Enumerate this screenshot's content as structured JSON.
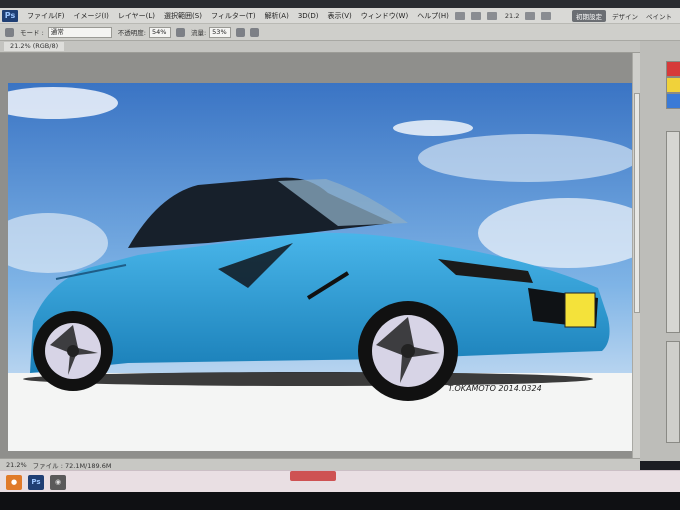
{
  "app": {
    "logo": "Ps"
  },
  "menu": {
    "items": [
      "ファイル(F)",
      "イメージ(I)",
      "レイヤー(L)",
      "選択範囲(S)",
      "フィルター(T)",
      "解析(A)",
      "3D(D)",
      "表示(V)",
      "ウィンドウ(W)",
      "ヘルプ(H)"
    ],
    "zoom": "21.2"
  },
  "workspace": {
    "essentials": "初期設定",
    "design": "デザイン",
    "paint": "ペイント"
  },
  "options": {
    "mode_label": "モード :",
    "mode_value": "通常",
    "opacity_label": "不透明度:",
    "opacity_value": "54%",
    "flow_label": "流量:",
    "flow_value": "53%"
  },
  "document": {
    "tab": "21.2% (RGB/8)"
  },
  "canvas": {
    "signature": "T.OKAMOTO 2014.0324"
  },
  "status": {
    "text": "ファイル : 72.1M/189.6M",
    "zoom": "21.2%"
  },
  "colors": {
    "car_body": "#2a9bd6",
    "sky_top": "#3a78c8",
    "accent": "#1f3f74"
  },
  "taskbar": {
    "apps": [
      "firefox-icon",
      "photoshop-icon",
      "app-icon"
    ]
  }
}
